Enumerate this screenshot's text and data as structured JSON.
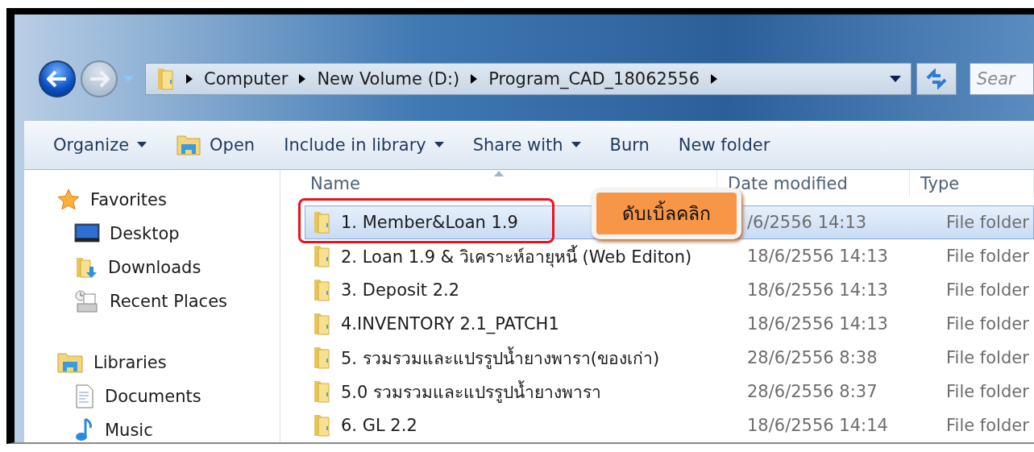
{
  "navigation": {
    "breadcrumbs": [
      "Computer",
      "New Volume (D:)",
      "Program_CAD_18062556"
    ],
    "search": {
      "placeholder": "Sear"
    }
  },
  "toolbar": {
    "buttons": [
      {
        "label": "Organize",
        "kind": "menu"
      },
      {
        "label": "Open",
        "kind": "icon"
      },
      {
        "label": "Include in library",
        "kind": "menu"
      },
      {
        "label": "Share with",
        "kind": "menu"
      },
      {
        "label": "Burn",
        "kind": "plain"
      },
      {
        "label": "New folder",
        "kind": "plain"
      }
    ]
  },
  "sidebar": {
    "groups": [
      {
        "label": "Favorites",
        "kind": "favorites",
        "items": [
          {
            "label": "Desktop",
            "kind": "desktop"
          },
          {
            "label": "Downloads",
            "kind": "downloads"
          },
          {
            "label": "Recent Places",
            "kind": "recent"
          }
        ]
      },
      {
        "label": "Libraries",
        "kind": "libraries",
        "items": [
          {
            "label": "Documents",
            "kind": "documents"
          },
          {
            "label": "Music",
            "kind": "music"
          }
        ]
      }
    ]
  },
  "table": {
    "columns": [
      {
        "label": "Name",
        "sorted": true
      },
      {
        "label": "Date modified",
        "sorted": false
      },
      {
        "label": "Type",
        "sorted": false
      }
    ],
    "rows": [
      {
        "name": "1. Member&Loan 1.9",
        "date": "/6/2556 14:13",
        "type": "File folder",
        "selected": true,
        "outlined": true
      },
      {
        "name": "2. Loan 1.9 & วิเคราะห์อายุหนี้ (Web Editon)",
        "date": "18/6/2556 14:13",
        "type": "File folder",
        "selected": false,
        "outlined": false
      },
      {
        "name": "3. Deposit 2.2",
        "date": "18/6/2556 14:13",
        "type": "File folder",
        "selected": false,
        "outlined": false
      },
      {
        "name": "4.INVENTORY 2.1_PATCH1",
        "date": "18/6/2556 14:13",
        "type": "File folder",
        "selected": false,
        "outlined": false
      },
      {
        "name": "5. รวมรวมและแปรรูปน้ำยางพารา(ของเก่า)",
        "date": "28/6/2556 8:38",
        "type": "File folder",
        "selected": false,
        "outlined": false
      },
      {
        "name": "5.0 รวมรวมและแปรรูปน้ำยางพารา",
        "date": "28/6/2556 8:37",
        "type": "File folder",
        "selected": false,
        "outlined": false
      },
      {
        "name": "6. GL 2.2",
        "date": "18/6/2556 14:14",
        "type": "File folder",
        "selected": false,
        "outlined": false
      }
    ]
  },
  "callout": {
    "text": "ดับเบิ้ลคลิก"
  }
}
